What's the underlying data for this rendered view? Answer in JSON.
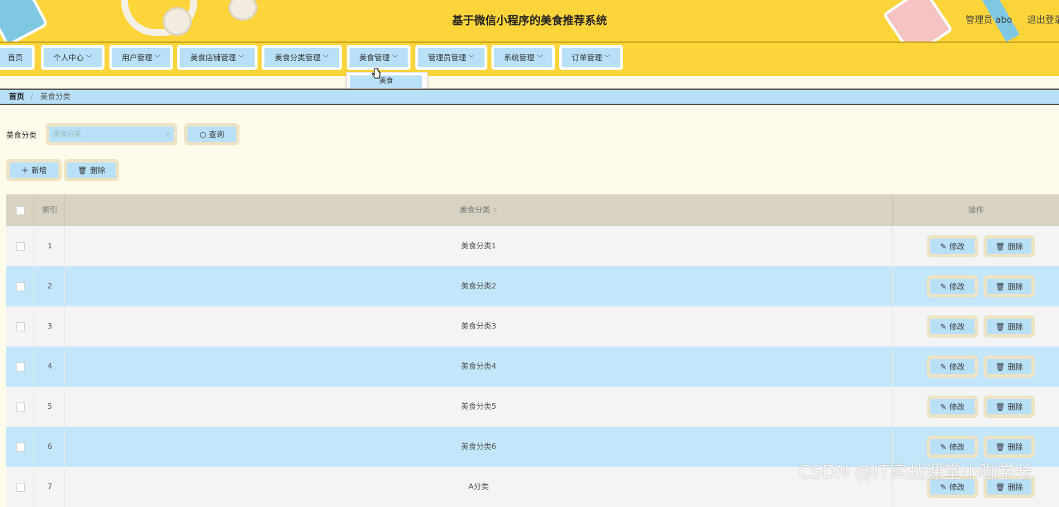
{
  "header": {
    "system_title": "基于微信小程序的美食推荐系统",
    "user": "管理员 abo",
    "logout": "退出登录"
  },
  "nav": {
    "items": [
      {
        "label": "首页",
        "has_dropdown": false
      },
      {
        "label": "个人中心",
        "has_dropdown": true
      },
      {
        "label": "用户管理",
        "has_dropdown": true
      },
      {
        "label": "美食店铺管理",
        "has_dropdown": true
      },
      {
        "label": "美食分类管理",
        "has_dropdown": true
      },
      {
        "label": "美食管理",
        "has_dropdown": true
      },
      {
        "label": "管理员管理",
        "has_dropdown": true
      },
      {
        "label": "系统管理",
        "has_dropdown": true
      },
      {
        "label": "订单管理",
        "has_dropdown": true
      }
    ],
    "open_dropdown": {
      "parent": "美食管理",
      "items": [
        "美食"
      ]
    },
    "chevron": "chevron-down-icon"
  },
  "breadcrumb": {
    "home": "首页",
    "separator": "/",
    "current": "美食分类"
  },
  "search": {
    "label": "美食分类",
    "placeholder": "美食分类",
    "query_button": "查询"
  },
  "actions": {
    "add": "新增",
    "delete": "删除"
  },
  "table": {
    "headers": {
      "index": "索引",
      "category": "美食分类",
      "actions": "操作"
    },
    "rows": [
      {
        "index": "1",
        "category": "美食分类1"
      },
      {
        "index": "2",
        "category": "美食分类2"
      },
      {
        "index": "3",
        "category": "美食分类3"
      },
      {
        "index": "4",
        "category": "美食分类4"
      },
      {
        "index": "5",
        "category": "美食分类5"
      },
      {
        "index": "6",
        "category": "美食分类6"
      },
      {
        "index": "7",
        "category": "A分类"
      }
    ],
    "row_actions": {
      "edit": "修改",
      "delete": "删除"
    }
  },
  "watermark": "CSDN @IT实战课堂小咖学长",
  "colors": {
    "header_bg": "#fdd53a",
    "button_bg": "#b8e0f7",
    "row_highlight": "#c4e6fa",
    "table_head": "#d8d3c1"
  }
}
